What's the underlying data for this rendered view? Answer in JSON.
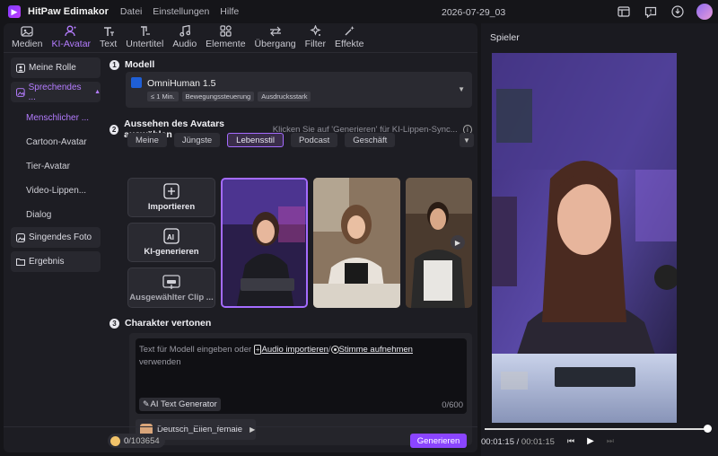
{
  "titlebar": {
    "app_name": "HitPaw Edimakor",
    "menus": [
      "Datei",
      "Einstellungen",
      "Hilfe"
    ],
    "date": "2026-07-29_03"
  },
  "tabs": [
    {
      "label": "Medien",
      "icon": "media-icon"
    },
    {
      "label": "KI-Avatar",
      "icon": "ai-avatar-icon",
      "active": true
    },
    {
      "label": "Text",
      "icon": "text-icon"
    },
    {
      "label": "Untertitel",
      "icon": "subtitle-icon"
    },
    {
      "label": "Audio",
      "icon": "audio-icon"
    },
    {
      "label": "Elemente",
      "icon": "elements-icon"
    },
    {
      "label": "Übergang",
      "icon": "transition-icon"
    },
    {
      "label": "Filter",
      "icon": "filter-icon"
    },
    {
      "label": "Effekte",
      "icon": "effects-icon"
    }
  ],
  "sidebar": {
    "items": [
      {
        "label": "Meine Rolle"
      },
      {
        "label": "Sprechendes ...",
        "active": true
      },
      {
        "label": "Singendes Foto"
      },
      {
        "label": "Ergebnis"
      }
    ],
    "sub_items": [
      "Menschlicher ...",
      "Cartoon-Avatar",
      "Tier-Avatar",
      "Video-Lippen...",
      "Dialog"
    ]
  },
  "section1": {
    "num": "1",
    "title": "Modell",
    "model_name": "OmniHuman 1.5",
    "tags": [
      "≤ 1 Min.",
      "Bewegungssteuerung",
      "Ausdrucksstark"
    ]
  },
  "section2": {
    "num": "2",
    "title": "Aussehen des Avatars auswählen",
    "hint": "Klicken Sie auf 'Generieren' für KI-Lippen-Sync...",
    "filters": [
      "Meine",
      "Jüngste",
      "Lebensstil",
      "Podcast",
      "Geschäft"
    ],
    "active_filter": "Lebensstil",
    "actions": [
      "Importieren",
      "KI-generieren",
      "Ausgewählter Clip ..."
    ]
  },
  "section3": {
    "num": "3",
    "title": "Charakter vertonen",
    "placeholder_pre": "Text für Modell eingeben oder",
    "link_import": "Audio importieren",
    "sep": "/",
    "link_record": "Stimme aufnehmen",
    "placeholder_post": "verwenden",
    "ai_text_btn": "AI Text Generator",
    "count": "0/600",
    "voice": "Deutsch_Ellen_female"
  },
  "footer": {
    "credits_current": "0",
    "credits_total": "/103654",
    "generate": "Generieren"
  },
  "player": {
    "label": "Spieler",
    "time_current": "00:01:15",
    "time_sep": " / ",
    "time_total": "00:01:15",
    "progress": 1.0
  },
  "colors": {
    "accent": "#b47cff",
    "button": "#8b45ff"
  }
}
